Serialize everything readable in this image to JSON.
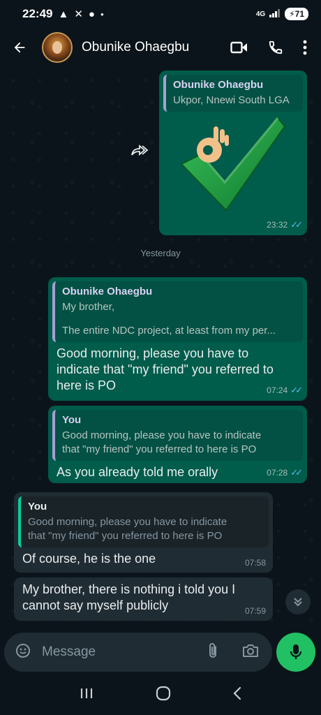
{
  "status_bar": {
    "time": "22:49",
    "network": "4G",
    "battery": "71"
  },
  "header": {
    "contact_name": "Obunike Ohaegbu",
    "icons": [
      "back-arrow-icon",
      "video-call-icon",
      "voice-call-icon",
      "more-options-icon"
    ]
  },
  "messages": [
    {
      "direction": "outgoing",
      "quote": {
        "author": "Obunike Ohaegbu",
        "text": "Ukpor, Nnewi South LGA"
      },
      "image": "ok-hand-checkmark-sticker",
      "time": "23:32",
      "status": "read"
    },
    {
      "type": "date_separator",
      "label": "Yesterday"
    },
    {
      "direction": "outgoing",
      "quote": {
        "author": "Obunike Ohaegbu",
        "line1": "My brother,",
        "line2": "The entire NDC project, at least from my per..."
      },
      "text_line1": "Good morning, please you have to",
      "text_line2": "indicate that \"my friend\" you referred to",
      "text_line3": "here is PO",
      "time": "07:24",
      "status": "read"
    },
    {
      "direction": "outgoing",
      "quote": {
        "author": "You",
        "line1": "Good morning, please you have to indicate",
        "line2": "that \"my friend\" you referred to here is PO"
      },
      "text": "As you already told me orally",
      "time": "07:28",
      "status": "read"
    },
    {
      "direction": "incoming",
      "quote": {
        "author": "You",
        "line1": "Good morning, please you have to indicate",
        "line2": "that \"my friend\" you referred to here is PO"
      },
      "text": "Of course, he is the one",
      "time": "07:58"
    },
    {
      "direction": "incoming",
      "text_line1": "My brother, there is nothing i told you I",
      "text_line2": "cannot say myself publicly",
      "time": "07:59"
    }
  ],
  "composer": {
    "placeholder": "Message",
    "icons": [
      "sticker-icon",
      "attach-icon",
      "camera-icon",
      "mic-icon"
    ]
  },
  "colors": {
    "outgoing_bubble": "#005c4b",
    "incoming_bubble": "#202c33",
    "background": "#0b141a",
    "accent_green": "#21c063",
    "read_ticks": "#53bdeb"
  }
}
